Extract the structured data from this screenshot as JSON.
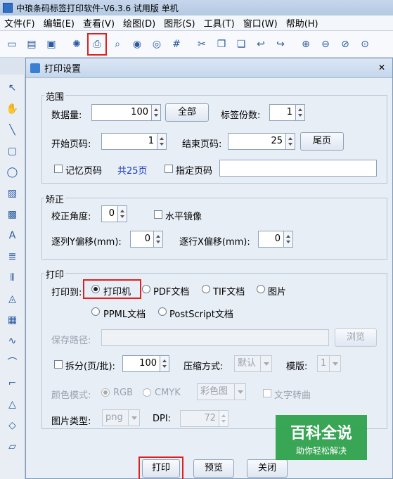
{
  "app": {
    "title": "中琅条码标签打印软件-V6.3.6 试用版 单机"
  },
  "menu": [
    "文件(F)",
    "编辑(E)",
    "查看(V)",
    "绘图(D)",
    "图形(S)",
    "工具(T)",
    "窗口(W)",
    "帮助(H)"
  ],
  "dialog": {
    "title": "打印设置",
    "range": {
      "label": "范围",
      "data_count_label": "数据量:",
      "data_count_value": "100",
      "all_button": "全部",
      "copies_label": "标签份数:",
      "copies_value": "1",
      "start_page_label": "开始页码:",
      "start_page_value": "1",
      "end_page_label": "结束页码:",
      "end_page_value": "25",
      "last_page_button": "尾页",
      "remember_label": "记忆页码",
      "total_pages": "共25页",
      "specify_label": "指定页码",
      "specify_value": ""
    },
    "correction": {
      "label": "矫正",
      "angle_label": "校正角度:",
      "angle_value": "0",
      "mirror_label": "水平镜像",
      "y_offset_label": "逐列Y偏移(mm):",
      "y_offset_value": "0",
      "x_offset_label": "逐行X偏移(mm):",
      "x_offset_value": "0"
    },
    "print": {
      "label": "打印",
      "print_to_label": "打印到:",
      "options": [
        "打印机",
        "PDF文档",
        "TIF文档",
        "图片",
        "PPML文档",
        "PostScript文档"
      ],
      "selected": "打印机",
      "save_path_label": "保存路径:",
      "browse_button": "浏览",
      "split_label": "拆分(页/批):",
      "split_value": "100",
      "compress_label": "压缩方式:",
      "compress_value": "默认",
      "template_label": "模版:",
      "template_value": "1",
      "color_mode_label": "颜色模式:",
      "rgb_label": "RGB",
      "cmyk_label": "CMYK",
      "color_value": "彩色图",
      "text_convert_label": "文字转曲",
      "image_type_label": "图片类型:",
      "image_type_value": "png",
      "dpi_label": "DPI:",
      "dpi_value": "72"
    },
    "buttons": {
      "print": "打印",
      "preview": "预览",
      "close": "关闭"
    }
  },
  "watermark": {
    "line1": "百科全说",
    "line2": "助你轻松解决"
  },
  "colors": {
    "highlight": "#e02020",
    "accent": "#2f6fc6"
  }
}
